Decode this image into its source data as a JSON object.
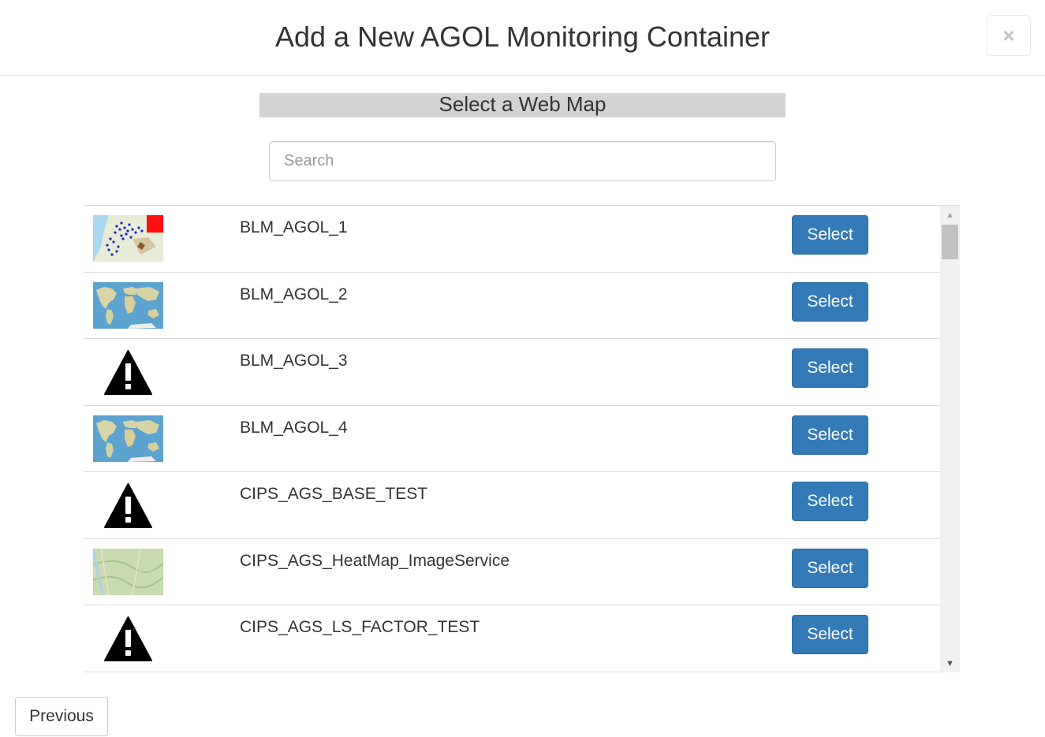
{
  "header": {
    "title": "Add a New AGOL Monitoring Container",
    "close_label": "×"
  },
  "section": {
    "title": "Select a Web Map"
  },
  "search": {
    "placeholder": "Search",
    "value": ""
  },
  "webmaps": [
    {
      "name": "BLM_AGOL_1",
      "thumbnail": "map-thumbnail-points",
      "select_label": "Select"
    },
    {
      "name": "BLM_AGOL_2",
      "thumbnail": "world-map-thumbnail",
      "select_label": "Select"
    },
    {
      "name": "BLM_AGOL_3",
      "thumbnail": "warning-icon",
      "select_label": "Select"
    },
    {
      "name": "BLM_AGOL_4",
      "thumbnail": "world-map-thumbnail",
      "select_label": "Select"
    },
    {
      "name": "CIPS_AGS_BASE_TEST",
      "thumbnail": "warning-icon",
      "select_label": "Select"
    },
    {
      "name": "CIPS_AGS_HeatMap_ImageService",
      "thumbnail": "topo-map-thumbnail",
      "select_label": "Select"
    },
    {
      "name": "CIPS_AGS_LS_FACTOR_TEST",
      "thumbnail": "warning-icon",
      "select_label": "Select"
    }
  ],
  "footer": {
    "previous_label": "Previous"
  },
  "colors": {
    "primary_button": "#337ab7",
    "section_title_bg": "#d3d3d3"
  }
}
